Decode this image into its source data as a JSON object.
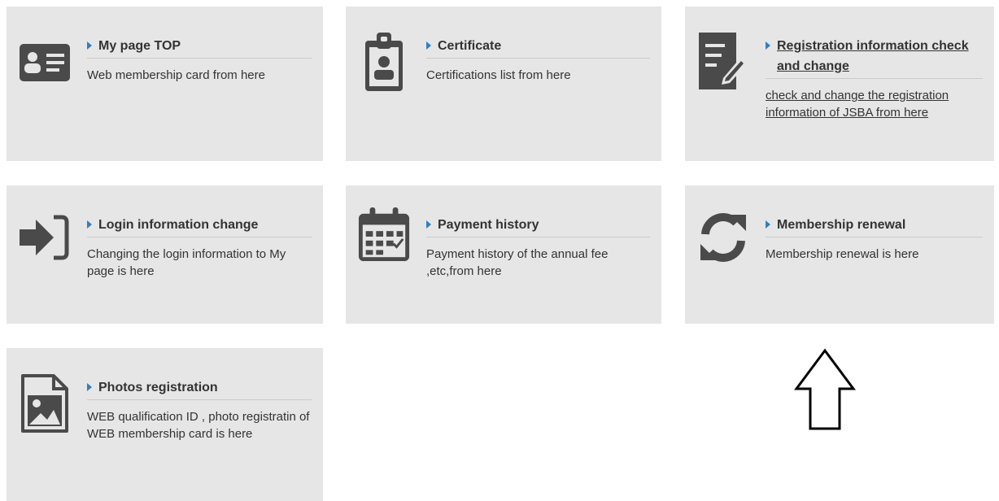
{
  "colors": {
    "card_bg": "#e6e6e6",
    "icon": "#4a4a4a",
    "accent_triangle": "#2f7fc1",
    "text": "#333333"
  },
  "cards": [
    {
      "icon": "id-card-icon",
      "title": "My page TOP",
      "desc": "Web membership card from here"
    },
    {
      "icon": "certificate-badge-icon",
      "title": "Certificate",
      "desc": "Certifications list from here"
    },
    {
      "icon": "edit-document-icon",
      "title": "Registration information check and change",
      "desc": "check and change the registration information of JSBA from here"
    },
    {
      "icon": "sign-in-icon",
      "title": "Login information change",
      "desc": "Changing the login information to My page is here"
    },
    {
      "icon": "calendar-icon",
      "title": "Payment history",
      "desc": "Payment history of the annual fee ,etc,from here"
    },
    {
      "icon": "refresh-icon",
      "title": "Membership renewal",
      "desc": "Membership renewal is here"
    },
    {
      "icon": "image-file-icon",
      "title": "Photos registration",
      "desc": "WEB qualification ID , photo registratin of WEB membership card is here"
    }
  ],
  "annotation": {
    "icon": "up-arrow-outline-icon"
  }
}
